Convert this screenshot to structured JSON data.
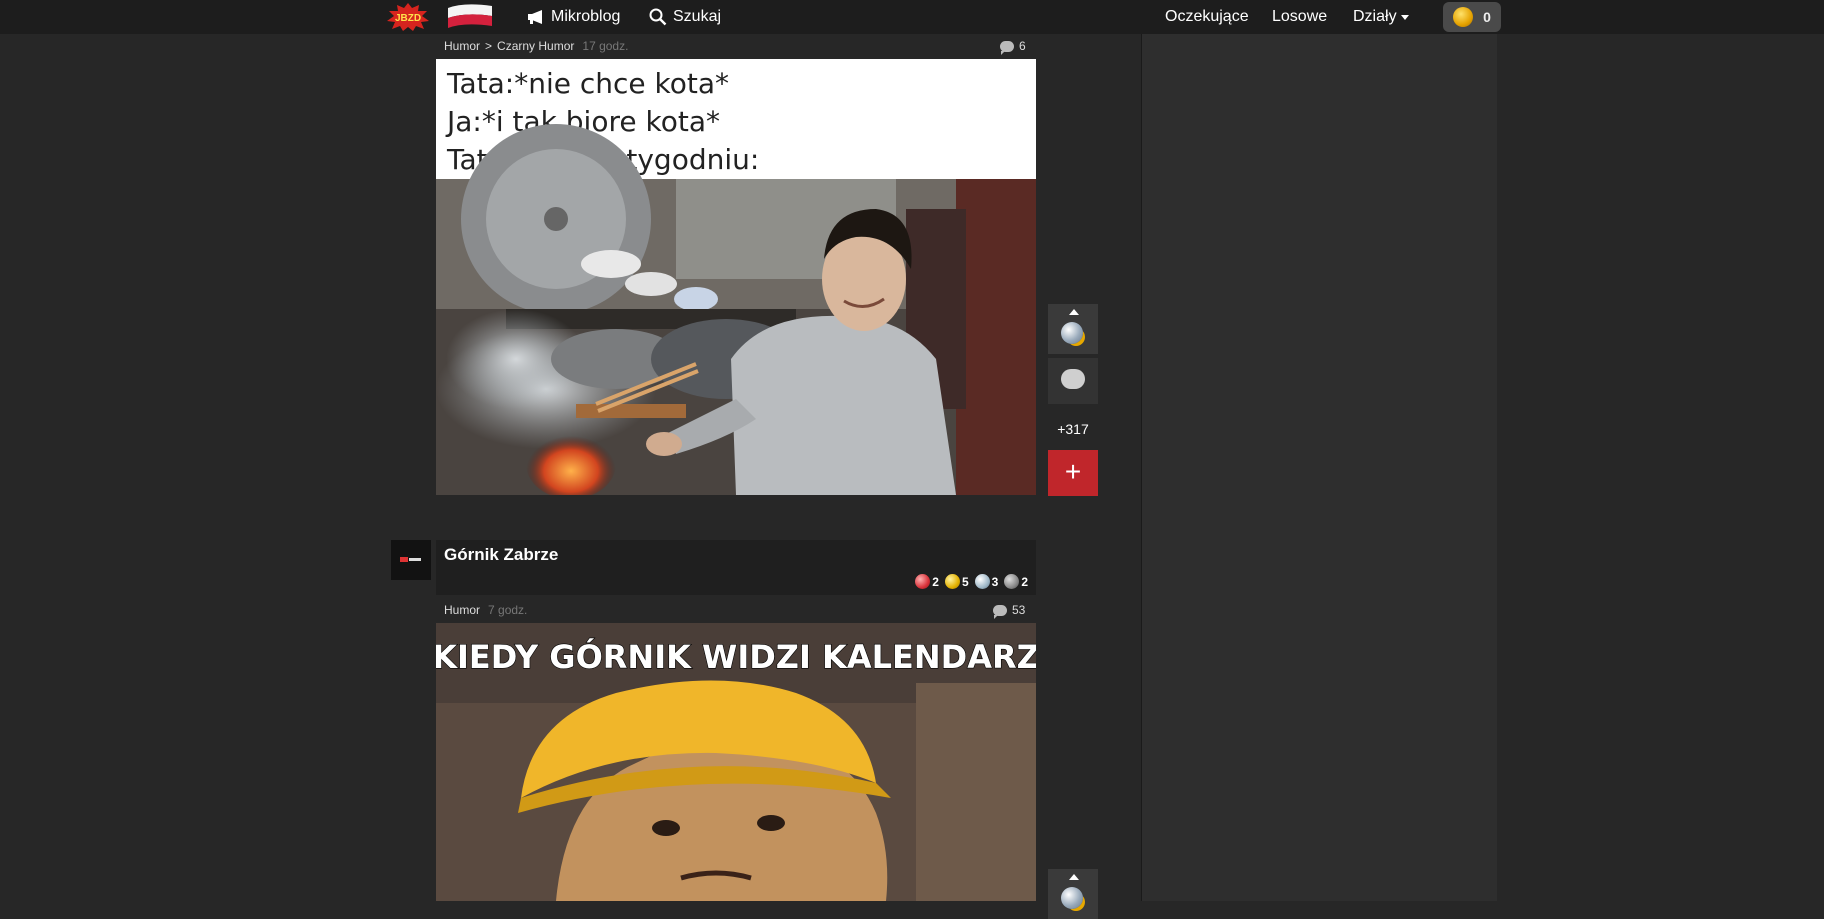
{
  "nav": {
    "logo_text": "JBZD",
    "mikroblog": "Mikroblog",
    "szukaj": "Szukaj",
    "oczekujace": "Oczekujące",
    "losowe": "Losowe",
    "dzialy": "Działy",
    "coins": "0"
  },
  "post1": {
    "category": "Humor",
    "subcategory": "Czarny Humor",
    "time": "17 godz.",
    "comments": "6",
    "image_text": [
      "Tata:*nie chce kota*",
      "Ja:*i tak biore kota*",
      "Tata i kot po tygodniu:"
    ],
    "score": "+317",
    "plus": "+"
  },
  "post2": {
    "author": "Górnik Zabrze",
    "badges": [
      {
        "kind": "red",
        "count": "2"
      },
      {
        "kind": "gold",
        "count": "5"
      },
      {
        "kind": "silver",
        "count": "3"
      },
      {
        "kind": "gray",
        "count": "2"
      }
    ],
    "category": "Humor",
    "time": "7 godz.",
    "comments": "53",
    "image_text": "KIEDY GÓRNIK WIDZI KALENDARZ"
  },
  "colors": {
    "accent_red": "#c0262b",
    "topbar": "#1d1d1d",
    "background": "#272727"
  }
}
